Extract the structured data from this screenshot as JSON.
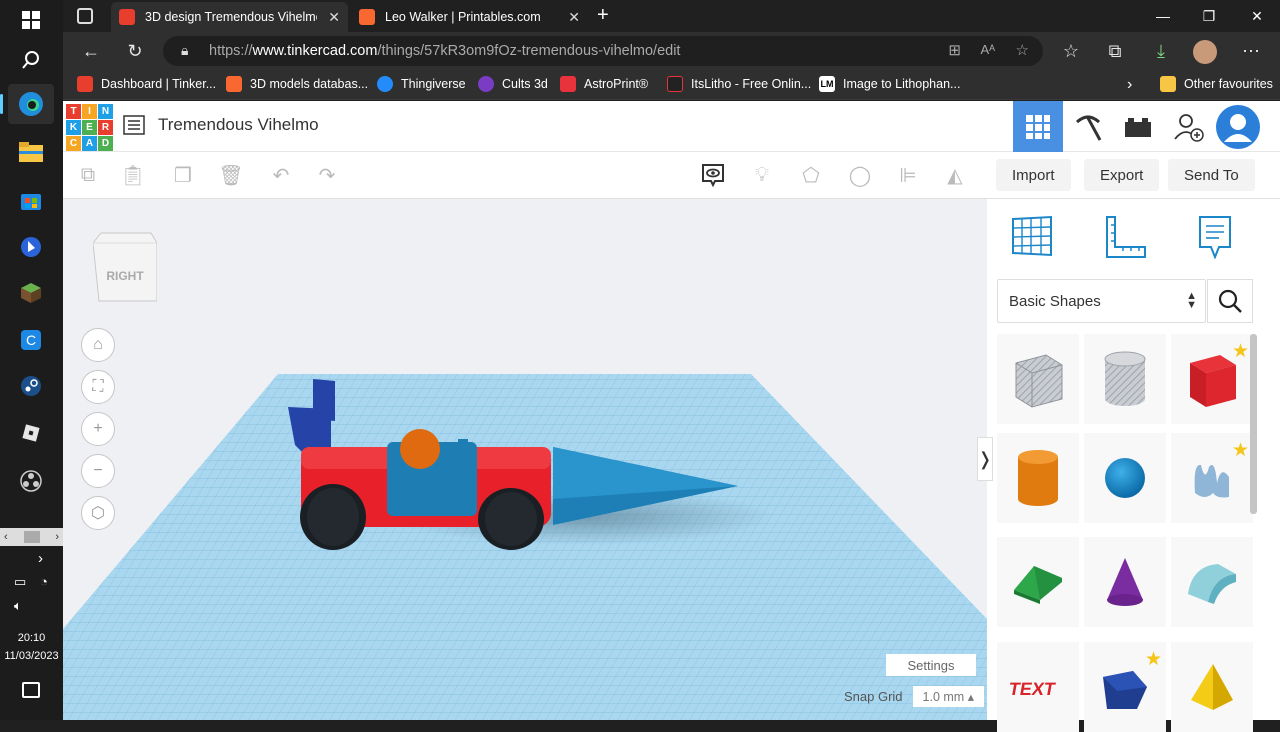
{
  "taskbar": {
    "time": "20:10",
    "date": "11/03/2023",
    "icons": [
      "windows-start-icon",
      "search-icon",
      "edge-icon",
      "file-explorer-icon",
      "store-icon",
      "bing-icon",
      "minecraft-icon",
      "app-c-icon",
      "steam-icon",
      "roblox-icon",
      "obs-icon"
    ]
  },
  "browser": {
    "tabs": [
      {
        "label": "3D design Tremendous Vihelmo",
        "favicon_color": "#e83e2e"
      },
      {
        "label": "Leo Walker | Printables.com",
        "favicon_color": "#fa6831"
      }
    ],
    "url_prefix": "https://",
    "url_host": "www.tinkercad.com",
    "url_path": "/things/57kR3om9fOz-tremendous-vihelmo/edit",
    "bookmarks": [
      {
        "label": "Dashboard | Tinker...",
        "color": "#e83e2e"
      },
      {
        "label": "3D models databas...",
        "color": "#fa6831"
      },
      {
        "label": "Thingiverse",
        "color": "#248bfb"
      },
      {
        "label": "Cults 3d",
        "color": "#7a3cc4"
      },
      {
        "label": "AstroPrint®",
        "color": "#e8323c"
      },
      {
        "label": "ItsLitho - Free Onlin...",
        "color": "#222222"
      },
      {
        "label": "Image to Lithophan...",
        "color": "#ffffff"
      }
    ],
    "other_favourites": "Other favourites"
  },
  "tinkercad": {
    "logo_letters": [
      "T",
      "I",
      "N",
      "K",
      "E",
      "R",
      "C",
      "A",
      "D"
    ],
    "logo_colors": [
      "#e83e2e",
      "#f6a623",
      "#1fa0e6",
      "#1fa0e6",
      "#4caf50",
      "#e83e2e",
      "#f6a623",
      "#1fa0e6",
      "#4caf50"
    ],
    "project_title": "Tremendous Vihelmo",
    "actions": {
      "import": "Import",
      "export": "Export",
      "send_to": "Send To"
    },
    "viewcube_label": "RIGHT",
    "settings": "Settings",
    "snap_grid_label": "Snap Grid",
    "snap_grid_value": "1.0 mm",
    "library": "Basic Shapes",
    "shapes": [
      {
        "name": "box-hole",
        "starred": false
      },
      {
        "name": "cylinder-hole",
        "starred": false
      },
      {
        "name": "box",
        "starred": true
      },
      {
        "name": "cylinder",
        "starred": false
      },
      {
        "name": "sphere",
        "starred": false
      },
      {
        "name": "scribble",
        "starred": true
      },
      {
        "name": "roof",
        "starred": false
      },
      {
        "name": "cone",
        "starred": false
      },
      {
        "name": "round-roof",
        "starred": false
      },
      {
        "name": "text",
        "starred": false
      },
      {
        "name": "polygon",
        "starred": true
      },
      {
        "name": "pyramid",
        "starred": false
      }
    ]
  }
}
